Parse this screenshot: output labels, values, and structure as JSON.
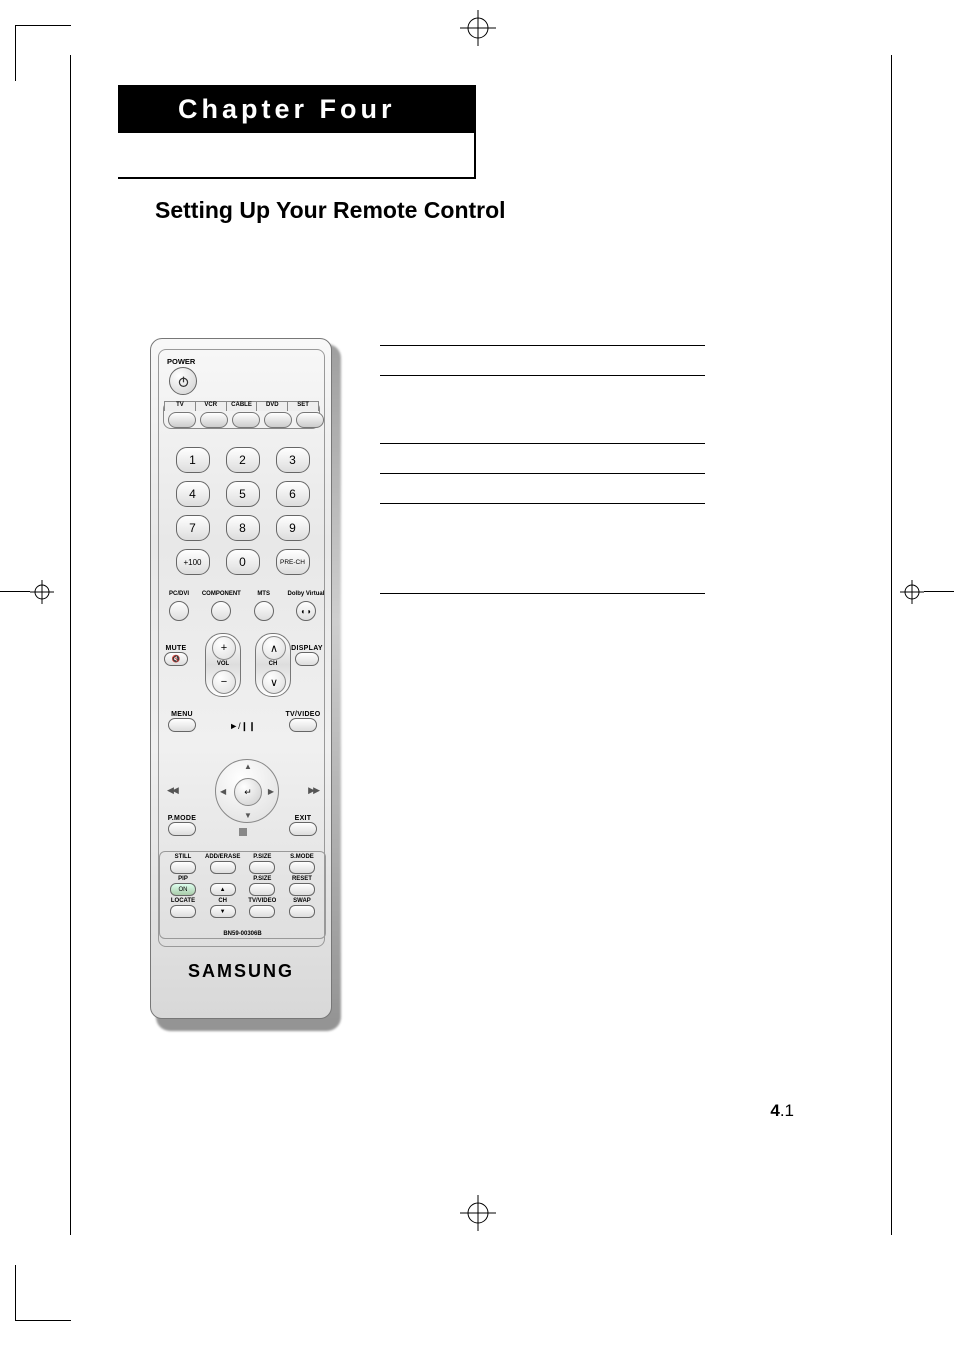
{
  "chapter_label": "Chapter Four",
  "section_title": "Setting Up Your Remote Control",
  "page_number": {
    "bold": "4",
    "rest": ".1"
  },
  "note_line_offsets": [
    0,
    30,
    98,
    128,
    158,
    248
  ],
  "remote": {
    "brand": "SAMSUNG",
    "model": "BN59-00306B",
    "power_label": "POWER",
    "mode_labels": [
      "TV",
      "VCR",
      "CABLE",
      "DVD",
      "SET"
    ],
    "numpad": [
      "1",
      "2",
      "3",
      "4",
      "5",
      "6",
      "7",
      "8",
      "9",
      "+100",
      "0",
      "PRE-CH"
    ],
    "row4": [
      {
        "label": "PC/DVI"
      },
      {
        "label": "COMPONENT"
      },
      {
        "label": "MTS"
      },
      {
        "label": "Dolby Virtual",
        "icon": "dolby"
      }
    ],
    "mute": "MUTE",
    "vol_label": "VOL",
    "ch_label": "CH",
    "display": "DISPLAY",
    "menu_row": {
      "left": "MENU",
      "center_icon": "►/❙❙",
      "right": "TV/VIDEO"
    },
    "pmode_row": {
      "left": "P.MODE",
      "stop": "■",
      "right": "EXIT"
    },
    "bottom_rows": [
      [
        "STILL",
        "ADD/ERASE",
        "P.SIZE",
        "S.MODE"
      ],
      [
        "PIP",
        "",
        "P.SIZE",
        "RESET"
      ],
      [
        "LOCATE",
        "CH",
        "TV/VIDEO",
        "SWAP"
      ]
    ],
    "pip_on": "ON"
  }
}
